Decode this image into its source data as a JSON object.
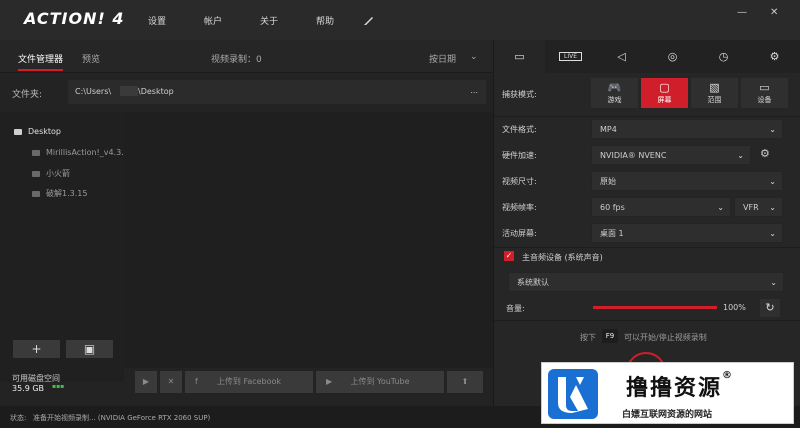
{
  "app": {
    "logo": "ACTION! 4",
    "menu": [
      "设置",
      "帐户",
      "关于",
      "帮助"
    ],
    "window_controls": {
      "minimize": "—",
      "close": "✕"
    }
  },
  "left": {
    "tabs": {
      "file_manager": "文件管理器",
      "preview": "预览"
    },
    "recording_count": "视频录制：0",
    "sort": "按日期",
    "folder_label": "文件夹:",
    "folder_path": "C:\\Users\\",
    "folder_path_end": "\\Desktop",
    "folder_more": "...",
    "tree": [
      {
        "label": "Desktop"
      },
      {
        "label": "MirillisAction!_v4.3.1..."
      },
      {
        "label": "小火箭"
      },
      {
        "label": "破解1.3.15"
      }
    ],
    "add_btn": "+",
    "folder_btn": "▣",
    "disk_label": "可用磁盘空间",
    "disk_value": "35.9 GB",
    "buttons": {
      "play": "▶",
      "delete": "✕",
      "facebook": "上传到 Facebook",
      "youtube": "上传到 YouTube",
      "upload": "⬆"
    }
  },
  "status": {
    "label": "状态:",
    "text": "准备开始视频录制... (NVIDIA GeForce RTX 2060 SUP)"
  },
  "right": {
    "tabs": [
      "▭",
      "LIVE",
      "◁",
      "◎",
      "◷",
      "⚙"
    ],
    "capture_mode_label": "捕获模式:",
    "modes": [
      {
        "icon": "🎮",
        "label": "游戏"
      },
      {
        "icon": "▢",
        "label": "屏幕"
      },
      {
        "icon": "▧",
        "label": "范围"
      },
      {
        "icon": "▭",
        "label": "设备"
      }
    ],
    "rows": [
      {
        "label": "文件格式:",
        "value": "MP4"
      },
      {
        "label": "硬件加速:",
        "value": "NVIDIA® NVENC"
      },
      {
        "label": "视频尺寸:",
        "value": "原始"
      },
      {
        "label": "视频帧率:",
        "value": "60 fps"
      },
      {
        "label": "活动屏幕:",
        "value": "桌面 1"
      }
    ],
    "vfr": "VFR",
    "audio_checkbox": "主音频设备 (系统声音)",
    "audio_device": "系统默认",
    "volume_label": "音量:",
    "volume_value": "100%",
    "hotkey_prefix": "按下",
    "hotkey": "F9",
    "hotkey_suffix": "可以开始/停止视频录制"
  },
  "watermark": {
    "title": "撸撸资源",
    "reg": "®",
    "subtitle": "白嫖互联网资源的网站"
  },
  "colors": {
    "accent": "#d01e2a",
    "bg": "#232323",
    "panel": "#262626"
  }
}
